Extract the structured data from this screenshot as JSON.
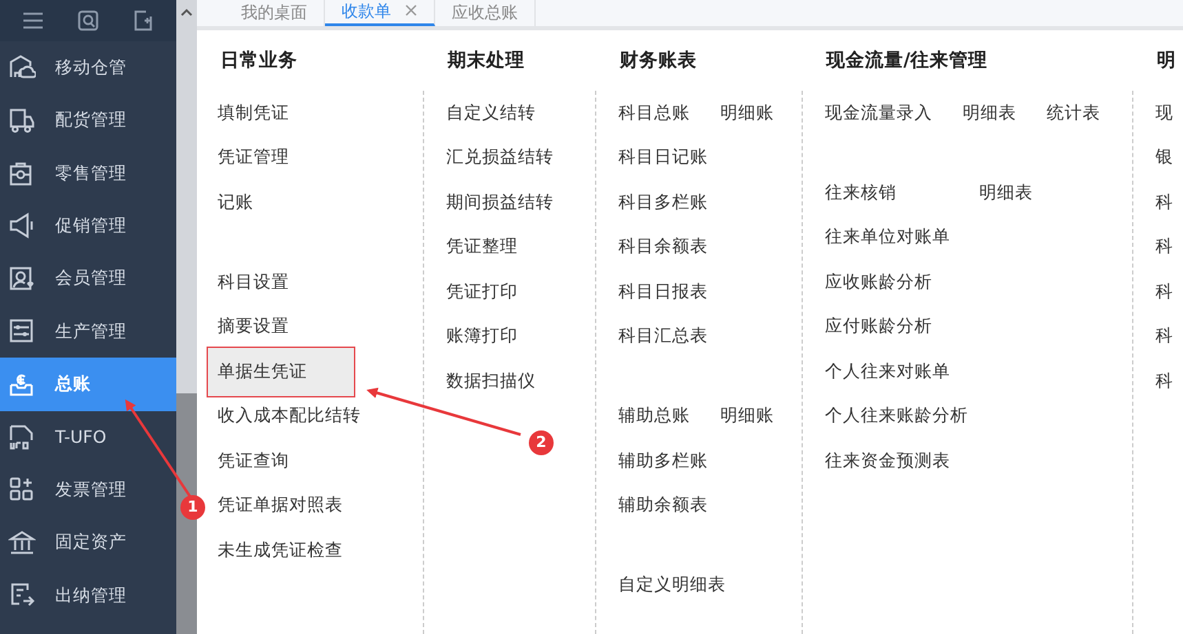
{
  "sidebar": {
    "items": [
      {
        "label": "移动仓管",
        "selected": false
      },
      {
        "label": "配货管理",
        "selected": false
      },
      {
        "label": "零售管理",
        "selected": false
      },
      {
        "label": "促销管理",
        "selected": false
      },
      {
        "label": "会员管理",
        "selected": false
      },
      {
        "label": "生产管理",
        "selected": false
      },
      {
        "label": "总账",
        "selected": true
      },
      {
        "label": "T-UFO",
        "selected": false
      },
      {
        "label": "发票管理",
        "selected": false
      },
      {
        "label": "固定资产",
        "selected": false
      },
      {
        "label": "出纳管理",
        "selected": false
      }
    ]
  },
  "tabs": [
    {
      "label": "我的桌面",
      "selected": false,
      "closable": false
    },
    {
      "label": "收款单",
      "selected": true,
      "closable": true
    },
    {
      "label": "应收总账",
      "selected": false,
      "closable": false
    }
  ],
  "menu": {
    "columns": [
      {
        "heading": "日常业务",
        "groups": [
          [
            [
              {
                "label": "填制凭证",
                "selected": false
              }
            ],
            [
              {
                "label": "凭证管理",
                "selected": false
              }
            ],
            [
              {
                "label": "记账",
                "selected": false
              }
            ]
          ],
          [
            [
              {
                "label": "科目设置",
                "selected": false
              }
            ],
            [
              {
                "label": "摘要设置",
                "selected": false
              }
            ],
            [
              {
                "label": "单据生凭证",
                "selected": true
              }
            ],
            [
              {
                "label": "收入成本配比结转",
                "selected": false
              }
            ],
            [
              {
                "label": "凭证查询",
                "selected": false
              }
            ],
            [
              {
                "label": "凭证单据对照表",
                "selected": false
              }
            ],
            [
              {
                "label": "未生成凭证检查",
                "selected": false
              }
            ]
          ]
        ]
      },
      {
        "heading": "期末处理",
        "groups": [
          [
            [
              {
                "label": "自定义结转",
                "selected": false
              }
            ],
            [
              {
                "label": "汇兑损益结转",
                "selected": false
              }
            ],
            [
              {
                "label": "期间损益结转",
                "selected": false
              }
            ],
            [
              {
                "label": "凭证整理",
                "selected": false
              }
            ],
            [
              {
                "label": "凭证打印",
                "selected": false
              }
            ],
            [
              {
                "label": "账簿打印",
                "selected": false
              }
            ],
            [
              {
                "label": "数据扫描仪",
                "selected": false
              }
            ]
          ]
        ]
      },
      {
        "heading": "财务账表",
        "groups": [
          [
            [
              {
                "label": "科目总账",
                "selected": false
              },
              {
                "label": "明细账",
                "selected": false
              }
            ],
            [
              {
                "label": "科目日记账",
                "selected": false
              }
            ],
            [
              {
                "label": "科目多栏账",
                "selected": false
              }
            ],
            [
              {
                "label": "科目余额表",
                "selected": false
              }
            ],
            [
              {
                "label": "科目日报表",
                "selected": false
              }
            ],
            [
              {
                "label": "科目汇总表",
                "selected": false
              }
            ]
          ],
          [
            [
              {
                "label": "辅助总账",
                "selected": false
              },
              {
                "label": "明细账",
                "selected": false
              }
            ],
            [
              {
                "label": "辅助多栏账",
                "selected": false
              }
            ],
            [
              {
                "label": "辅助余额表",
                "selected": false
              }
            ]
          ],
          [
            [
              {
                "label": "自定义明细表",
                "selected": false
              }
            ]
          ]
        ]
      },
      {
        "heading": "现金流量/往来管理",
        "groups": [
          [
            [
              {
                "label": "现金流量录入",
                "selected": false
              },
              {
                "label": "明细表",
                "selected": false
              },
              {
                "label": "统计表",
                "selected": false
              }
            ]
          ],
          [
            [
              {
                "label": "往来核销",
                "selected": false
              },
              {
                "label": "明细表",
                "selected": false
              }
            ],
            [
              {
                "label": "往来单位对账单",
                "selected": false
              }
            ],
            [
              {
                "label": "应收账龄分析",
                "selected": false
              }
            ],
            [
              {
                "label": "应付账龄分析",
                "selected": false
              }
            ],
            [
              {
                "label": "个人往来对账单",
                "selected": false
              }
            ],
            [
              {
                "label": "个人往来账龄分析",
                "selected": false
              }
            ],
            [
              {
                "label": "往来资金预测表",
                "selected": false
              }
            ]
          ]
        ]
      },
      {
        "heading": "明",
        "groups": [
          [
            [
              {
                "label": "现",
                "selected": false
              }
            ],
            [
              {
                "label": "银",
                "selected": false
              }
            ],
            [
              {
                "label": "科",
                "selected": false
              }
            ],
            [
              {
                "label": "科",
                "selected": false
              }
            ],
            [
              {
                "label": "科",
                "selected": false
              }
            ],
            [
              {
                "label": "科",
                "selected": false
              }
            ],
            [
              {
                "label": "科",
                "selected": false
              }
            ]
          ]
        ]
      }
    ]
  },
  "annotations": [
    {
      "number": "1"
    },
    {
      "number": "2"
    }
  ]
}
